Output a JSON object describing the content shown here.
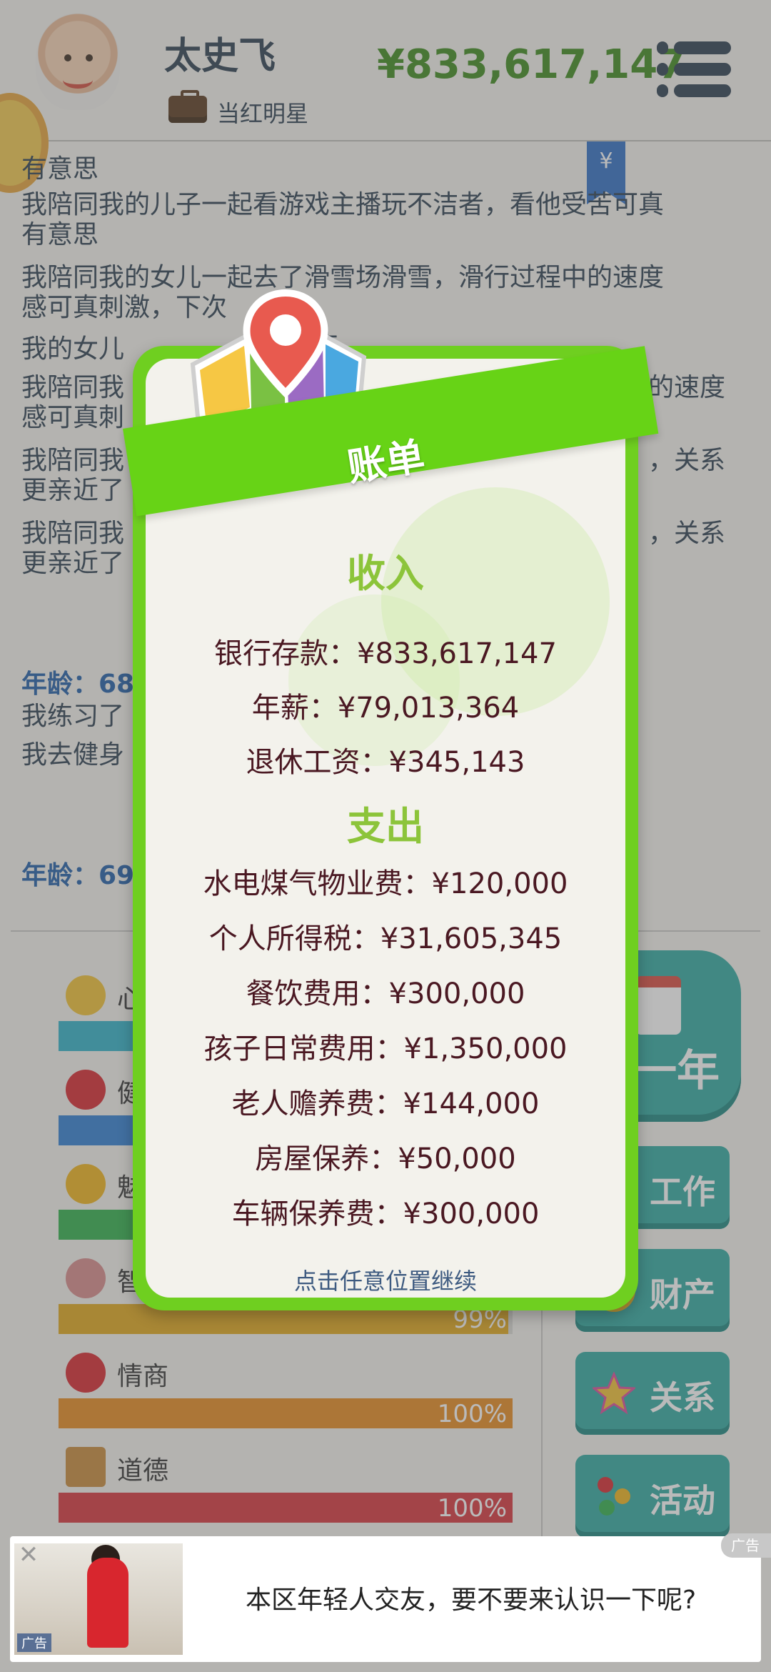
{
  "header": {
    "name": "太史飞",
    "title": "当红明星",
    "money": "¥833,617,147"
  },
  "bookmark_symbol": "¥",
  "log": {
    "lines": [
      "有意思",
      "我陪同我的儿子一起看游戏主播玩不洁者，看他受苦可真",
      "有意思",
      "我陪同我的女儿一起去了滑雪场滑雪，滑行过程中的速度",
      "感可真刺激，下次",
      "我的女儿",
      "我陪同我",
      "感可真刺",
      "我陪同我",
      "更亲近了",
      "我陪同我",
      "更亲近了"
    ],
    "right_fragments": [
      "去",
      "的速度",
      "，关系",
      "，关系"
    ],
    "age_1": "年龄：68",
    "age_1_lines": [
      "我练习了",
      "我去健身"
    ],
    "age_2": "年龄：69"
  },
  "stats": [
    {
      "label": "心",
      "value": "",
      "color": "#2fb2c8",
      "icon": "smile-icon"
    },
    {
      "label": "健",
      "value": "",
      "color": "#2f7fd2",
      "icon": "heart-icon"
    },
    {
      "label": "魅",
      "value": "",
      "color": "#2fb04a",
      "icon": "sun-icon"
    },
    {
      "label": "智",
      "value": "99%",
      "color": "#e0a81a",
      "icon": "brain-icon"
    },
    {
      "label": "情商",
      "value": "100%",
      "color": "#e78a1e",
      "icon": "apple-icon"
    },
    {
      "label": "道德",
      "value": "100%",
      "color": "#d8343c",
      "icon": "scales-icon"
    }
  ],
  "side_buttons": {
    "next_year": "一年",
    "work": "工作",
    "assets": "财产",
    "relations": "关系",
    "activities": "活动"
  },
  "bill": {
    "title": "账单",
    "income_title": "收入",
    "income": [
      "银行存款：¥833,617,147",
      "年薪：¥79,013,364",
      "退休工资：¥345,143"
    ],
    "expense_title": "支出",
    "expenses": [
      "水电煤气物业费：¥120,000",
      "个人所得税：¥31,605,345",
      "餐饮费用：¥300,000",
      "孩子日常费用：¥1,350,000",
      "老人赡养费：¥144,000",
      "房屋保养：¥50,000",
      "车辆保养费：¥300,000"
    ],
    "continue_hint": "点击任意位置继续"
  },
  "ad": {
    "text": "本区年轻人交友，要不要来认识一下呢?",
    "label": "广告",
    "image_tag": "广告"
  },
  "colors": {
    "money": "#3d8a1d",
    "modal_border": "#6fcf20",
    "section_title": "#8cc43a",
    "bill_text": "#4a1822",
    "button": "#2fa9a0"
  }
}
